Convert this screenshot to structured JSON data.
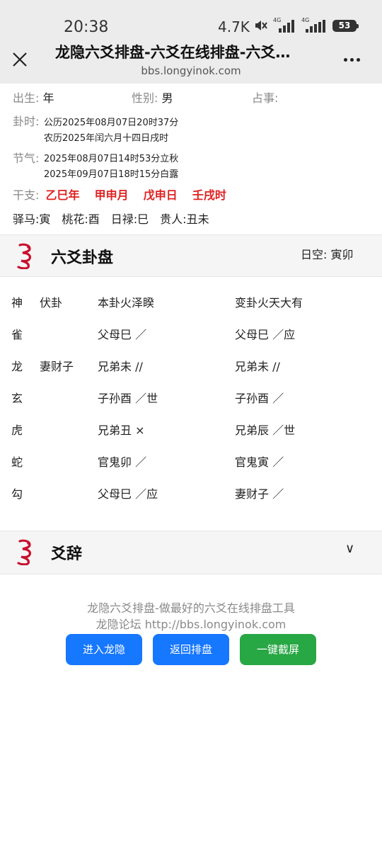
{
  "status_bar": {
    "time": "20:38",
    "speed": "4.7K",
    "signal_tag_1": "4G",
    "signal_tag_2": "4G",
    "battery": "53"
  },
  "browser": {
    "title": "龙隐六爻排盘-六爻在线排盘-六爻…",
    "url": "bbs.longyinok.com"
  },
  "info": {
    "birth_label": "出生:",
    "birth_value": "年",
    "gender_label": "性别:",
    "gender_value": "男",
    "matter_label": "占事:",
    "matter_value": "",
    "time_label": "卦时:",
    "time_solar": "公历2025年08月07日20时37分",
    "time_lunar": "农历2025年闰六月十四日戌时",
    "term_label": "节气:",
    "term_1": "2025年08月07日14时53分立秋",
    "term_2": "2025年09月07日18时15分白露",
    "ganzhi_label": "干支:",
    "ganzhi": [
      "乙巳年",
      "甲申月",
      "戊申日",
      "壬戌时"
    ],
    "extras": "驿马:寅　桃花:酉　日禄:巳　贵人:丑未"
  },
  "gua_section": {
    "title": "六爻卦盘",
    "kong": "日空: 寅卯",
    "header": {
      "god": "神",
      "fu": "伏卦",
      "ben": "本卦火泽睽",
      "bian": "变卦火天大有"
    },
    "rows": [
      {
        "god": "雀",
        "fu": "",
        "ben": "父母巳 ／",
        "bian": "父母巳 ／应"
      },
      {
        "god": "龙",
        "fu": "妻财子",
        "ben": "兄弟未 //",
        "bian": "兄弟未 //"
      },
      {
        "god": "玄",
        "fu": "",
        "ben": "子孙酉 ／世",
        "bian": "子孙酉 ／"
      },
      {
        "god": "虎",
        "fu": "",
        "ben": "兄弟丑 ×",
        "bian": "兄弟辰 ／世"
      },
      {
        "god": "蛇",
        "fu": "",
        "ben": "官鬼卯 ／",
        "bian": "官鬼寅 ／"
      },
      {
        "god": "勾",
        "fu": "",
        "ben": "父母巳 ／应",
        "bian": "妻财子 ／"
      }
    ]
  },
  "yaoci_section": {
    "title": "爻辞",
    "toggle": "∨"
  },
  "footer": {
    "line1": "龙隐六爻排盘-做最好的六爻在线排盘工具",
    "line2": "龙隐论坛 http://bbs.longyinok.com",
    "btn_enter": "进入龙隐",
    "btn_back": "返回排盘",
    "btn_screenshot": "一键截屏"
  },
  "colors": {
    "blue_button": "#1677ff",
    "green_button": "#28a745",
    "ganzhi_red": "#e02020",
    "logo_red": "#c8102e"
  }
}
